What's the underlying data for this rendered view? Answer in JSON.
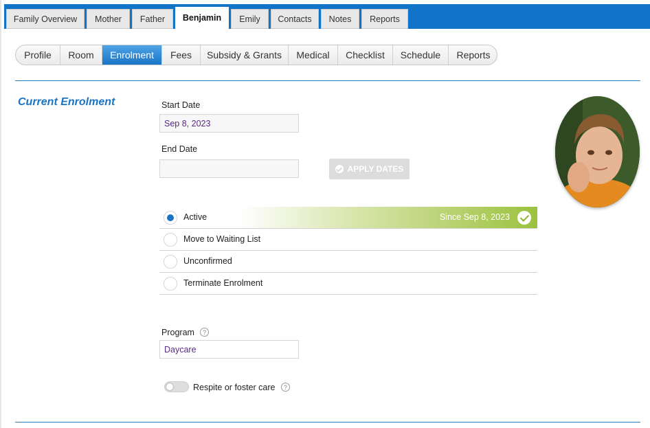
{
  "family_tabs": [
    {
      "label": "Family Overview",
      "active": false
    },
    {
      "label": "Mother",
      "active": false
    },
    {
      "label": "Father",
      "active": false
    },
    {
      "label": "Benjamin",
      "active": true
    },
    {
      "label": "Emily",
      "active": false
    },
    {
      "label": "Contacts",
      "active": false
    },
    {
      "label": "Notes",
      "active": false
    },
    {
      "label": "Reports",
      "active": false
    }
  ],
  "sub_tabs": [
    {
      "label": "Profile",
      "active": false
    },
    {
      "label": "Room",
      "active": false
    },
    {
      "label": "Enrolment",
      "active": true
    },
    {
      "label": "Fees",
      "active": false
    },
    {
      "label": "Subsidy & Grants",
      "active": false
    },
    {
      "label": "Medical",
      "active": false
    },
    {
      "label": "Checklist",
      "active": false
    },
    {
      "label": "Schedule",
      "active": false
    },
    {
      "label": "Reports",
      "active": false
    }
  ],
  "enrolment": {
    "section_title": "Current Enrolment",
    "start_date_label": "Start Date",
    "start_date_value": "Sep 8, 2023",
    "end_date_label": "End Date",
    "end_date_value": "",
    "apply_button_label": "APPLY DATES",
    "statuses": [
      {
        "label": "Active",
        "selected": true,
        "since": "Since Sep 8, 2023"
      },
      {
        "label": "Move to Waiting List",
        "selected": false
      },
      {
        "label": "Unconfirmed",
        "selected": false
      },
      {
        "label": "Terminate Enrolment",
        "selected": false
      }
    ],
    "program_label": "Program",
    "program_value": "Daycare",
    "respite_label": "Respite or foster care",
    "respite_enabled": false,
    "help_glyph": "?"
  },
  "colors": {
    "primary": "#1274c9",
    "active_green": "#9cc23f",
    "value_text": "#5a2a82"
  },
  "icons": [
    "help-icon",
    "check-circle-icon",
    "radio-button"
  ]
}
